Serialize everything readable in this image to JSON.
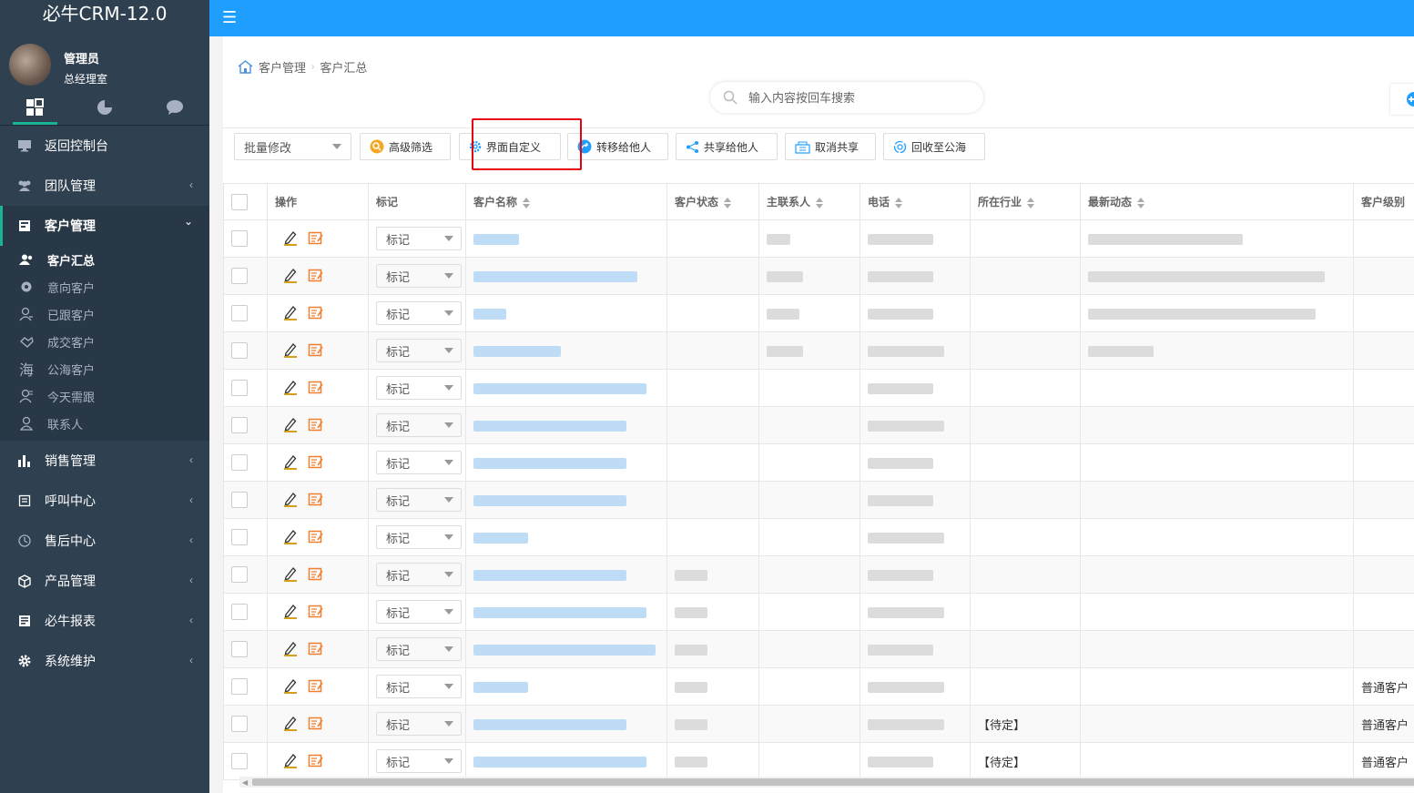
{
  "app": {
    "title": "必牛CRM-12.0"
  },
  "user": {
    "name": "管理员",
    "role": "总经理室"
  },
  "sidebar": {
    "tabs": [
      {
        "icon": "grid-icon"
      },
      {
        "icon": "pie-chart-icon"
      },
      {
        "icon": "chat-icon"
      }
    ],
    "items": [
      {
        "label": "返回控制台",
        "icon": "monitor-icon"
      },
      {
        "label": "团队管理",
        "icon": "team-icon",
        "arrow": "‹"
      },
      {
        "label": "客户管理",
        "icon": "customer-icon",
        "arrow": "⌄"
      },
      {
        "label": "销售管理",
        "icon": "bar-chart-icon",
        "arrow": "‹"
      },
      {
        "label": "呼叫中心",
        "icon": "phone-book-icon",
        "arrow": "‹"
      },
      {
        "label": "售后中心",
        "icon": "service-icon",
        "arrow": "‹"
      },
      {
        "label": "产品管理",
        "icon": "cube-icon",
        "arrow": "‹"
      },
      {
        "label": "必牛报表",
        "icon": "report-icon",
        "arrow": "‹"
      },
      {
        "label": "系统维护",
        "icon": "gear-icon",
        "arrow": "‹"
      }
    ],
    "submenu": [
      {
        "label": "客户汇总",
        "icon": "users-icon"
      },
      {
        "label": "意向客户",
        "icon": "target-icon"
      },
      {
        "label": "已跟客户",
        "icon": "user-follow-icon"
      },
      {
        "label": "成交客户",
        "icon": "handshake-icon"
      },
      {
        "label": "公海客户",
        "icon": "sea-icon",
        "glyph": "海"
      },
      {
        "label": "今天需跟",
        "icon": "user-today-icon"
      },
      {
        "label": "联系人",
        "icon": "contact-icon"
      }
    ]
  },
  "topbar": {
    "menu_icon": "☰"
  },
  "breadcrumb": {
    "home_icon": "home-icon",
    "level1": "客户管理",
    "sep": "›",
    "level2": "客户汇总"
  },
  "search": {
    "placeholder": "输入内容按回车搜索"
  },
  "toolbar": {
    "batch_select": "批量修改",
    "buttons": [
      {
        "label": "高级筛选",
        "icon": "filter-icon",
        "color": "#f5a623"
      },
      {
        "label": "界面自定义",
        "icon": "settings-icon",
        "color": "#1e9fff"
      },
      {
        "label": "转移给他人",
        "icon": "transfer-icon",
        "color": "#1e9fff"
      },
      {
        "label": "共享给他人",
        "icon": "share-icon",
        "color": "#1e9fff"
      },
      {
        "label": "取消共享",
        "icon": "cancel-share-icon",
        "color": "#1e9fff"
      },
      {
        "label": "回收至公海",
        "icon": "recycle-icon",
        "color": "#1e9fff"
      }
    ]
  },
  "table": {
    "columns": [
      "操作",
      "标记",
      "客户名称",
      "客户状态",
      "主联系人",
      "电话",
      "所在行业",
      "最新动态",
      "客户级别"
    ],
    "mark_label": "标记",
    "rows": [
      {
        "name_w": 50,
        "status_w": 0,
        "contact_w": 26,
        "phone_w": 72,
        "industry": "",
        "activity_w": 170,
        "level": ""
      },
      {
        "name_w": 180,
        "status_w": 0,
        "contact_w": 40,
        "phone_w": 72,
        "industry": "",
        "activity_w": 260,
        "level": ""
      },
      {
        "name_w": 36,
        "status_w": 0,
        "contact_w": 36,
        "phone_w": 72,
        "industry": "",
        "activity_w": 250,
        "level": ""
      },
      {
        "name_w": 96,
        "status_w": 0,
        "contact_w": 40,
        "phone_w": 84,
        "industry": "",
        "activity_w": 72,
        "level": ""
      },
      {
        "name_w": 190,
        "status_w": 0,
        "contact_w": 0,
        "phone_w": 72,
        "industry": "",
        "activity_w": 0,
        "level": ""
      },
      {
        "name_w": 168,
        "status_w": 0,
        "contact_w": 0,
        "phone_w": 84,
        "industry": "",
        "activity_w": 0,
        "level": ""
      },
      {
        "name_w": 168,
        "status_w": 0,
        "contact_w": 0,
        "phone_w": 72,
        "industry": "",
        "activity_w": 0,
        "level": ""
      },
      {
        "name_w": 168,
        "status_w": 0,
        "contact_w": 0,
        "phone_w": 72,
        "industry": "",
        "activity_w": 0,
        "level": ""
      },
      {
        "name_w": 60,
        "status_w": 0,
        "contact_w": 0,
        "phone_w": 84,
        "industry": "",
        "activity_w": 0,
        "level": ""
      },
      {
        "name_w": 168,
        "status_w": 36,
        "contact_w": 0,
        "phone_w": 72,
        "industry": "",
        "activity_w": 0,
        "level": ""
      },
      {
        "name_w": 190,
        "status_w": 36,
        "contact_w": 0,
        "phone_w": 84,
        "industry": "",
        "activity_w": 0,
        "level": ""
      },
      {
        "name_w": 200,
        "status_w": 36,
        "contact_w": 0,
        "phone_w": 72,
        "industry": "",
        "activity_w": 0,
        "level": ""
      },
      {
        "name_w": 60,
        "status_w": 36,
        "contact_w": 0,
        "phone_w": 84,
        "industry": "",
        "activity_w": 0,
        "level": "普通客户"
      },
      {
        "name_w": 168,
        "status_w": 36,
        "contact_w": 0,
        "phone_w": 84,
        "industry": "【待定】",
        "activity_w": 0,
        "level": "普通客户"
      },
      {
        "name_w": 190,
        "status_w": 36,
        "contact_w": 0,
        "phone_w": 72,
        "industry": "【待定】",
        "activity_w": 0,
        "level": "普通客户"
      }
    ]
  },
  "colors": {
    "sidebar_bg": "#2f4050",
    "topbar_bg": "#1e9fff",
    "accent": "#1ab394",
    "highlight": "#e60012",
    "edit_icon": "#d4a017",
    "detail_icon": "#f08030"
  }
}
